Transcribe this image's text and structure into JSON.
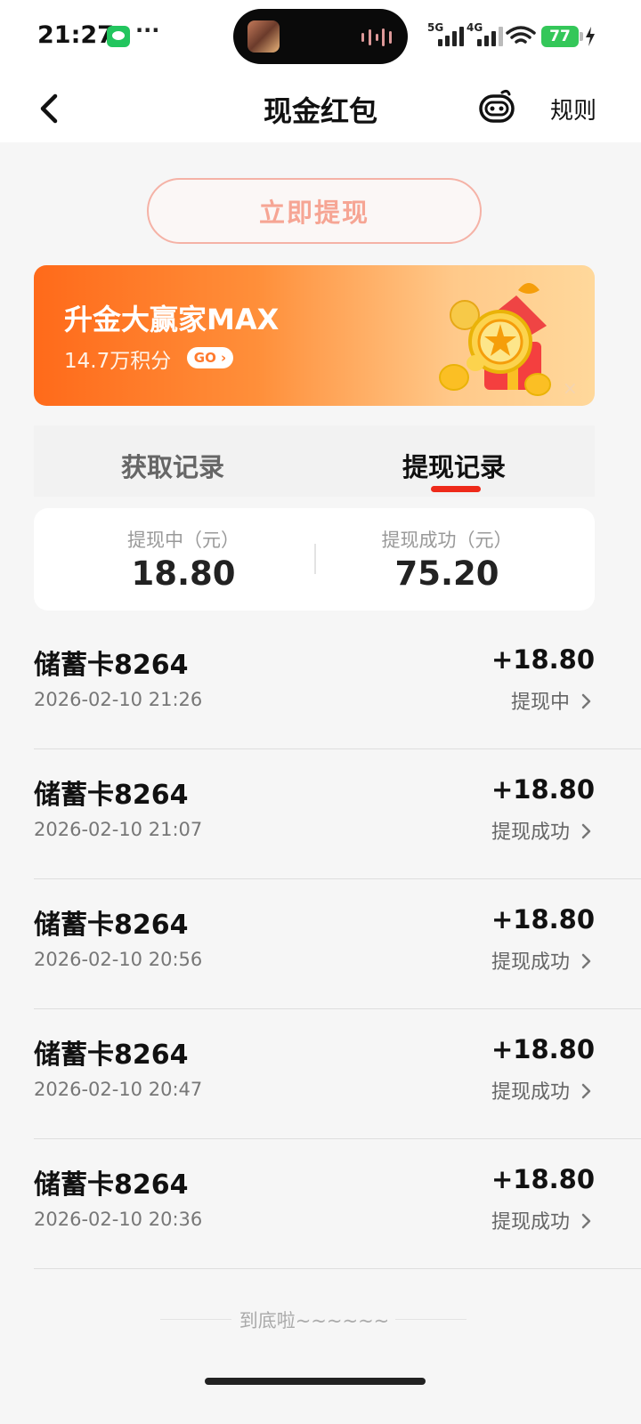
{
  "status_bar": {
    "time": "21:27",
    "dots": "···",
    "net1": "5G",
    "net2": "4G",
    "battery": "77"
  },
  "header": {
    "title": "现金红包",
    "rules": "规则"
  },
  "withdraw_button": "立即提现",
  "banner": {
    "title": "升金大赢家MAX",
    "subtitle": "14.7万积分",
    "go": "GO ›",
    "close": "×"
  },
  "tabs": {
    "acquire": "获取记录",
    "withdraw": "提现记录",
    "active": "withdraw"
  },
  "summary": {
    "pending_label": "提现中（元）",
    "pending_value": "18.80",
    "success_label": "提现成功（元）",
    "success_value": "75.20"
  },
  "records": [
    {
      "title": "储蓄卡8264",
      "date": "2026-02-10 21:26",
      "amount": "+18.80",
      "status": "提现中"
    },
    {
      "title": "储蓄卡8264",
      "date": "2026-02-10 21:07",
      "amount": "+18.80",
      "status": "提现成功"
    },
    {
      "title": "储蓄卡8264",
      "date": "2026-02-10 20:56",
      "amount": "+18.80",
      "status": "提现成功"
    },
    {
      "title": "储蓄卡8264",
      "date": "2026-02-10 20:47",
      "amount": "+18.80",
      "status": "提现成功"
    },
    {
      "title": "储蓄卡8264",
      "date": "2026-02-10 20:36",
      "amount": "+18.80",
      "status": "提现成功"
    }
  ],
  "footer": {
    "end_text": "到底啦~~~~~~"
  },
  "colors": {
    "accent_red": "#ee2a1a",
    "banner_orange": "#ff6a1a",
    "button_border": "#f5b2a6"
  }
}
